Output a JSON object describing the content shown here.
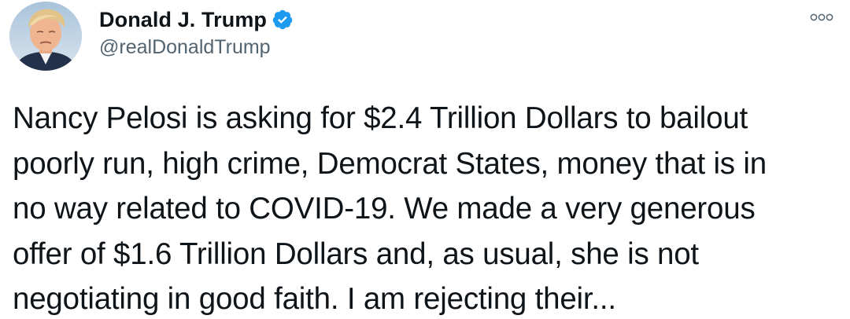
{
  "author": {
    "display_name": "Donald J. Trump",
    "handle": "@realDonaldTrump",
    "verified": true,
    "verified_color": "#1d9bf0"
  },
  "menu": {
    "icon": "more-options-icon"
  },
  "tweet": {
    "text": "Nancy Pelosi is asking for $2.4 Trillion Dollars to bailout\npoorly run, high crime, Democrat States, money that is in\nno way related to COVID-19. We made a very generous\noffer of $1.6 Trillion Dollars and, as usual, she is not\nnegotiating in good faith. I am rejecting their..."
  },
  "colors": {
    "text": "#0f1419",
    "secondary": "#536471",
    "background": "#ffffff"
  }
}
